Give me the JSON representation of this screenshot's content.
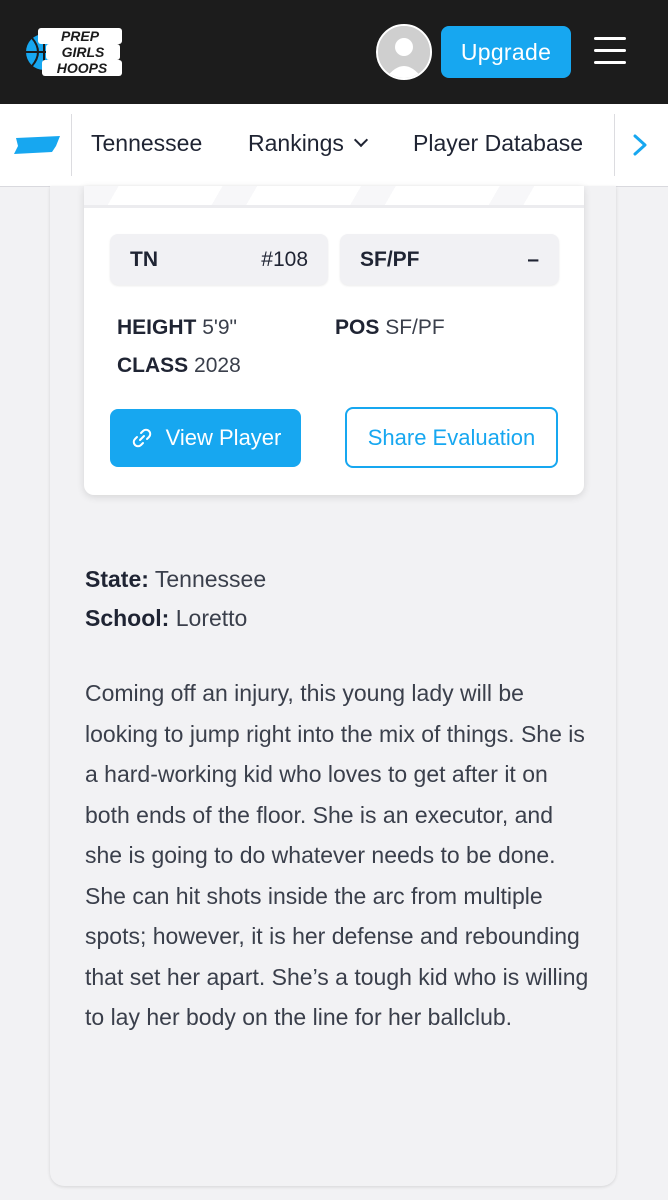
{
  "header": {
    "logo_lines": [
      "PREP",
      "GIRLS",
      "HOOPS"
    ],
    "upgrade_label": "Upgrade",
    "avatar_icon": "user-avatar-icon",
    "menu_icon": "hamburger-menu-icon"
  },
  "subnav": {
    "state_icon": "tennessee-shape-icon",
    "items": [
      {
        "label": "Tennessee"
      },
      {
        "label": "Rankings"
      },
      {
        "label": "Player Database"
      }
    ],
    "next_icon": "chevron-right-icon"
  },
  "player_card": {
    "state_abbr": "TN",
    "rank": "#108",
    "position": "SF/PF",
    "position_rank": "–",
    "height_label": "HEIGHT",
    "height_value": "5'9\"",
    "pos_label": "POS",
    "pos_value": "SF/PF",
    "class_label": "CLASS",
    "class_value": "2028",
    "view_button": "View Player",
    "share_button": "Share Evaluation"
  },
  "details": {
    "state_label": "State:",
    "state_value": "Tennessee",
    "school_label": "School:",
    "school_value": "Loretto"
  },
  "evaluation": "Coming off an injury, this young lady will be looking to jump right into the mix of things. She is a hard-working kid who loves to get after it on both ends of the floor. She is an executor, and she is going to do whatever needs to be done. She can hit shots inside the arc from multiple spots; however, it is her defense and rebounding that set her apart. She’s a tough kid who is willing to lay her body on the line for her ballclub.",
  "colors": {
    "accent": "#17a7f0",
    "header_bg": "#1c1c1c",
    "page_bg": "#f2f2f4"
  }
}
